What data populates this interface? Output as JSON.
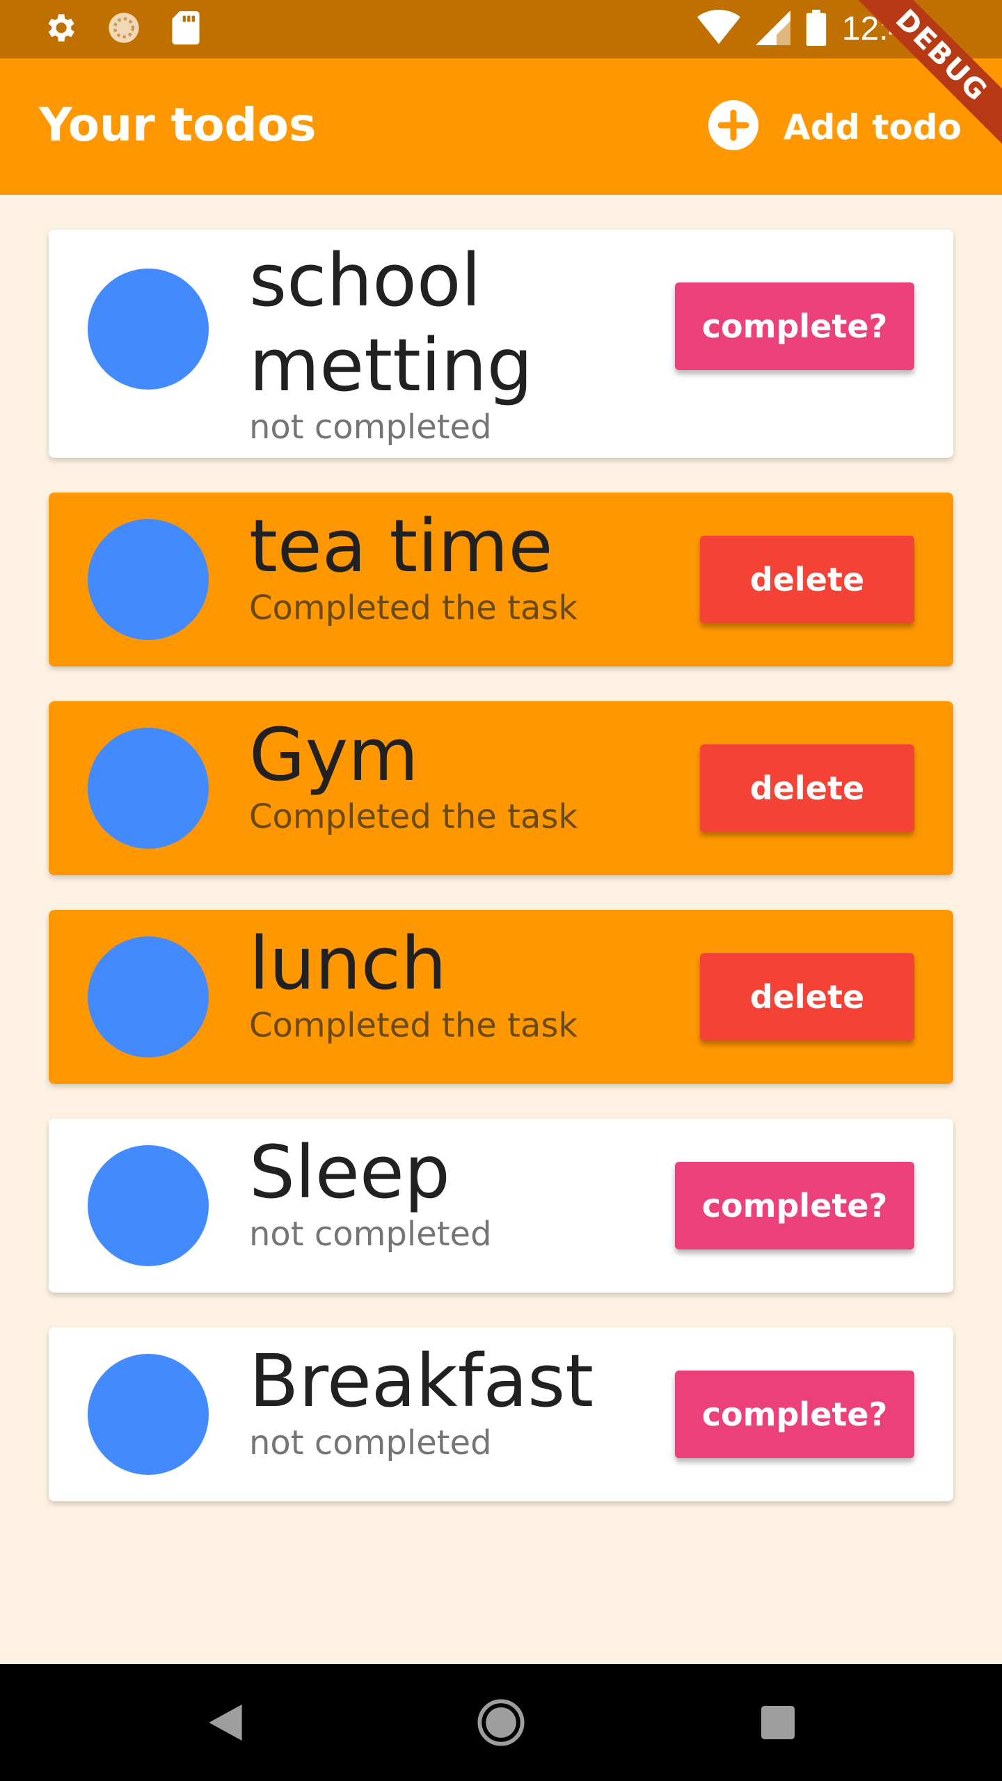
{
  "status_bar": {
    "time": "12:44",
    "icons": [
      "gear-icon",
      "sync-icon",
      "sd-card-icon",
      "wifi-icon",
      "signal-icon",
      "battery-icon"
    ]
  },
  "debug_banner": "DEBUG",
  "app_bar": {
    "title": "Your todos",
    "add_label": "Add todo"
  },
  "todos": [
    {
      "title": "school metting",
      "status": "not completed",
      "completed": false,
      "action": "complete?"
    },
    {
      "title": "tea time",
      "status": "Completed the task",
      "completed": true,
      "action": "delete"
    },
    {
      "title": "Gym",
      "status": "Completed the task",
      "completed": true,
      "action": "delete"
    },
    {
      "title": "lunch",
      "status": "Completed the task",
      "completed": true,
      "action": "delete"
    },
    {
      "title": "Sleep",
      "status": "not completed",
      "completed": false,
      "action": "complete?"
    },
    {
      "title": "Breakfast",
      "status": "not completed",
      "completed": false,
      "action": "complete?"
    }
  ],
  "colors": {
    "app_bar": "#ff9800",
    "status_bar": "#bf7000",
    "background": "#fdf1e1",
    "completed_card": "#ff9800",
    "open_card": "#ffffff",
    "avatar": "#448aff",
    "complete_button": "#ec407a",
    "delete_button": "#f44336"
  }
}
